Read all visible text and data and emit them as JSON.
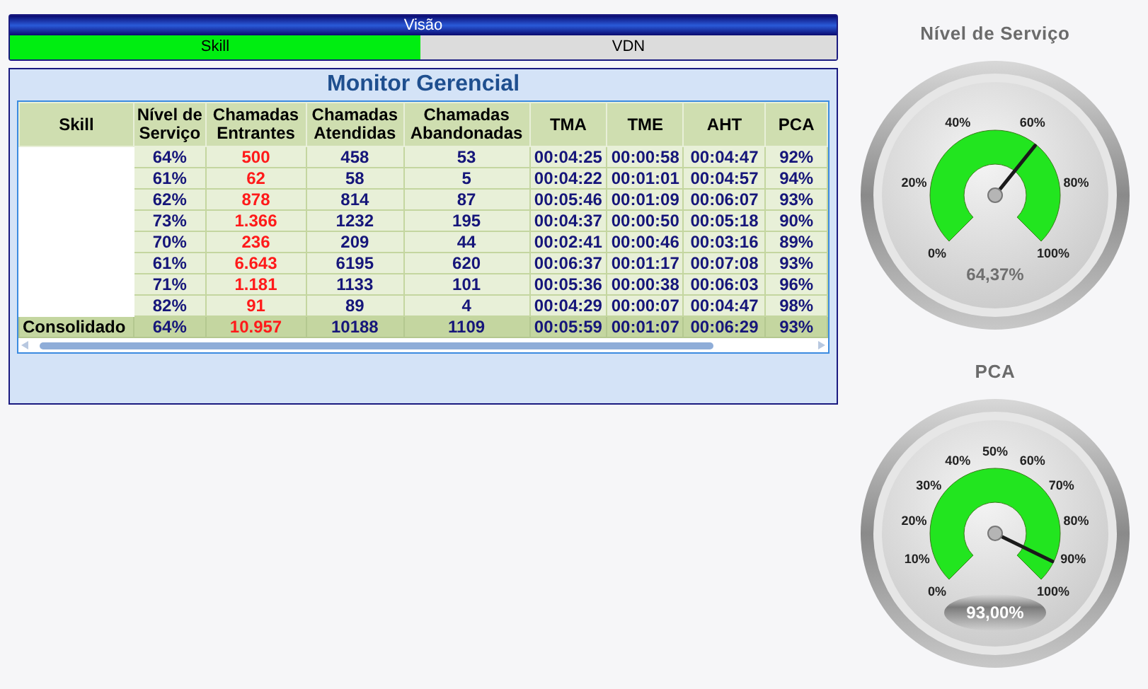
{
  "view_panel": {
    "title": "Visão",
    "tabs": [
      {
        "label": "Skill",
        "selected": true
      },
      {
        "label": "VDN",
        "selected": false
      }
    ]
  },
  "monitor": {
    "title": "Monitor Gerencial",
    "columns": [
      {
        "label": "Skill"
      },
      {
        "label": "Nível de Serviço",
        "color": "#16167a"
      },
      {
        "label": "Chamadas Entrantes",
        "color": "#ff1a1a"
      },
      {
        "label": "Chamadas Atendidas",
        "color": "#16167a"
      },
      {
        "label": "Chamadas Abandonadas",
        "color": "#16167a"
      },
      {
        "label": "TMA",
        "color": "#16167a"
      },
      {
        "label": "TME",
        "color": "#16167a"
      },
      {
        "label": "AHT",
        "color": "#16167a"
      },
      {
        "label": "PCA",
        "color": "#16167a"
      }
    ],
    "rows": [
      {
        "kind": "skill",
        "cells": [
          "",
          "64%",
          "500",
          "458",
          "53",
          "00:04:25",
          "00:00:58",
          "00:04:47",
          "92%"
        ]
      },
      {
        "kind": "skill",
        "cells": [
          "",
          "61%",
          "62",
          "58",
          "5",
          "00:04:22",
          "00:01:01",
          "00:04:57",
          "94%"
        ]
      },
      {
        "kind": "skill",
        "cells": [
          "",
          "62%",
          "878",
          "814",
          "87",
          "00:05:46",
          "00:01:09",
          "00:06:07",
          "93%"
        ]
      },
      {
        "kind": "skill",
        "cells": [
          "",
          "73%",
          "1.366",
          "1232",
          "195",
          "00:04:37",
          "00:00:50",
          "00:05:18",
          "90%"
        ]
      },
      {
        "kind": "skill",
        "cells": [
          "",
          "70%",
          "236",
          "209",
          "44",
          "00:02:41",
          "00:00:46",
          "00:03:16",
          "89%"
        ]
      },
      {
        "kind": "skill",
        "cells": [
          "",
          "61%",
          "6.643",
          "6195",
          "620",
          "00:06:37",
          "00:01:17",
          "00:07:08",
          "93%"
        ]
      },
      {
        "kind": "skill",
        "cells": [
          "",
          "71%",
          "1.181",
          "1133",
          "101",
          "00:05:36",
          "00:00:38",
          "00:06:03",
          "96%"
        ]
      },
      {
        "kind": "skill",
        "cells": [
          "",
          "82%",
          "91",
          "89",
          "4",
          "00:04:29",
          "00:00:07",
          "00:04:47",
          "98%"
        ]
      },
      {
        "kind": "total",
        "cells": [
          "Consolidado",
          "64%",
          "10.957",
          "10188",
          "1109",
          "00:05:59",
          "00:01:07",
          "00:06:29",
          "93%"
        ]
      }
    ]
  },
  "gauges": [
    {
      "title": "Nível de Serviço",
      "level": 0.6437,
      "reading": "64,37%",
      "ticks": [
        "0%",
        "20%",
        "40%",
        "60%",
        "80%",
        "100%"
      ]
    },
    {
      "title": "PCA",
      "level": 0.93,
      "reading": "93,00%",
      "ticks": [
        "0%",
        "10%",
        "20%",
        "30%",
        "40%",
        "50%",
        "60%",
        "70%",
        "80%",
        "90%",
        "100%"
      ]
    }
  ]
}
